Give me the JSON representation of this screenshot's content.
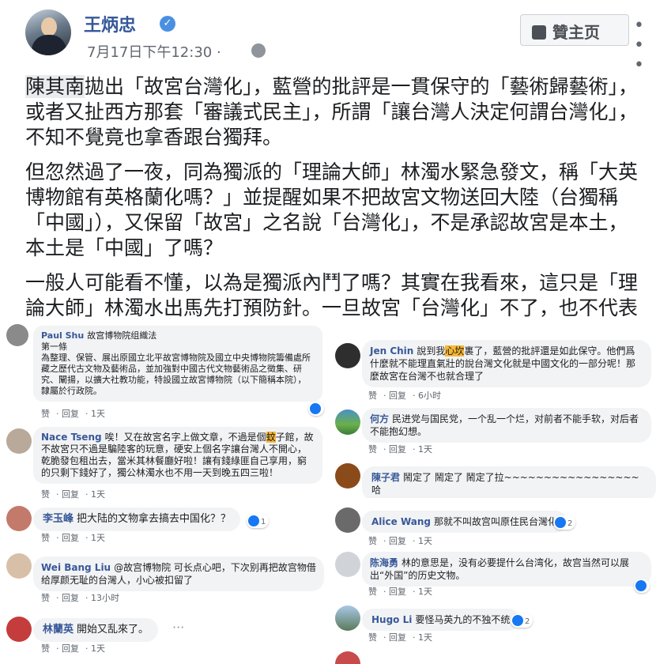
{
  "post": {
    "author": "王炳忠",
    "timestamp": "7月17日下午12:30 ·",
    "like_page_label": "贊主页",
    "paragraphs": [
      {
        "tagged": "陳其南",
        "text": "拋出「故宮台灣化」，藍營的批評是一貫保守的「藝術歸藝術」，或者又扯西方那套「審議式民主」，所謂「讓台灣人決定何謂台灣化」，不知不覺竟也拿香跟台獨拜。"
      },
      {
        "tagged": "",
        "text": "但忽然過了一夜，同為獨派的「理論大師」林濁水緊急發文，稱「大英博物館有英格蘭化嗎？」並提醒如果不把故宮文物送回大陸（台獨稱「中國」），又保留「故宮」之名說「台灣化」，不是承認故宮是本土，本土是「中國」了嗎？"
      },
      {
        "tagged": "",
        "text": "一般人可能看不懂，以為是獨派內鬥了嗎？其實在我看來，這只是「理論大師」林濁水出馬先打預防針。一旦故宮「台灣化」不了，也不代表"
      }
    ]
  },
  "left_comments": [
    {
      "name": "Paul Shu",
      "text": "故宫博物院组織法\n第一條\n為整理、保管、展出原國立北平故宮博物院及國立中央博物院籌備處所藏之歷代古文物及藝術品，並加強對中國古代文物藝術品之徵集、研究、闡揚，以擴大社教功能，特設國立故宮博物院（以下簡稱本院），隸屬於行政院。",
      "actions": [
        "赞",
        "回复",
        "1天"
      ],
      "reactions": ""
    },
    {
      "name": "Nace Tseng",
      "text_before": "唉！又在故宮名字上做文章，不過是個",
      "highlight": "蚊",
      "text_after": "子館，故不故宮只不過是騙陸客的玩意，硬安上個名字讓台灣人不開心，乾脆發包租出去，當米其林餐廳好啦！讓有錢綠匪自己享用，窮的只剩下錢好了，獨公林濁水也不用一天到晚五四三啦！",
      "actions": [
        "赞",
        "回复",
        "1天"
      ],
      "reactions": ""
    },
    {
      "name": "李玉峰",
      "text": "把大陆的文物拿去搞去中国化？？",
      "actions": [
        "赞",
        "回复",
        "1天"
      ],
      "reactions": "1"
    },
    {
      "name": "Wei Bang Liu",
      "text": "@故宫博物院 可长点心吧，下次别再把故宫物借给厚颜无耻的台灣人，小心被扣留了",
      "actions": [
        "赞",
        "回复",
        "13小时"
      ],
      "reactions": ""
    },
    {
      "name": "林蘭英",
      "text": "開始又乱來了。",
      "actions": [
        "赞",
        "回复",
        "1天"
      ],
      "reactions": ""
    }
  ],
  "right_comments": [
    {
      "name": "Jen Chin",
      "text_before": "說到我",
      "highlight": "心坎",
      "text_after": "裏了，藍營的批評還是如此保守。他們爲什麼就不能理直氣壯的說台灣文化就是中國文化的一部分呢！那麼故宮在台灣不也就合理了",
      "actions": [
        "赞",
        "回复",
        "6小时"
      ],
      "reactions": ""
    },
    {
      "name": "何方",
      "text": "民进党与国民党，一个乱一个烂，对前者不能手软，对后者不能抱幻想。",
      "actions": [
        "赞",
        "回复",
        "1天"
      ],
      "reactions": ""
    },
    {
      "name": "陳子君",
      "text": "鬧定了 鬧定了 鬧定了拉~~~~~~~~~~~~~~~~~ 哈",
      "actions": [],
      "reactions": ""
    },
    {
      "name": "Alice Wang",
      "text": "那就不叫故宫叫原住民台灣化",
      "actions": [
        "赞",
        "回复",
        "1天"
      ],
      "reactions": "2"
    },
    {
      "name": "陈海勇",
      "text": "林的意思是，没有必要提什么台湾化，故宫当然可以展出“外国”的历史文物。",
      "actions": [
        "赞",
        "回复",
        "1天"
      ],
      "reactions": ""
    },
    {
      "name": "Hugo Li",
      "text": "要怪马英九的不独不统",
      "actions": [
        "赞",
        "回复",
        "1天"
      ],
      "reactions": "2"
    }
  ],
  "colors": {
    "link": "#365899",
    "bubble": "#f2f3f5",
    "reaction_blue": "#1877f2",
    "highlight": "#f7b733"
  },
  "icons": [
    "verified-badge-icon",
    "globe-icon",
    "thumbs-up-icon",
    "more-options-icon",
    "like-reaction-icon"
  ]
}
